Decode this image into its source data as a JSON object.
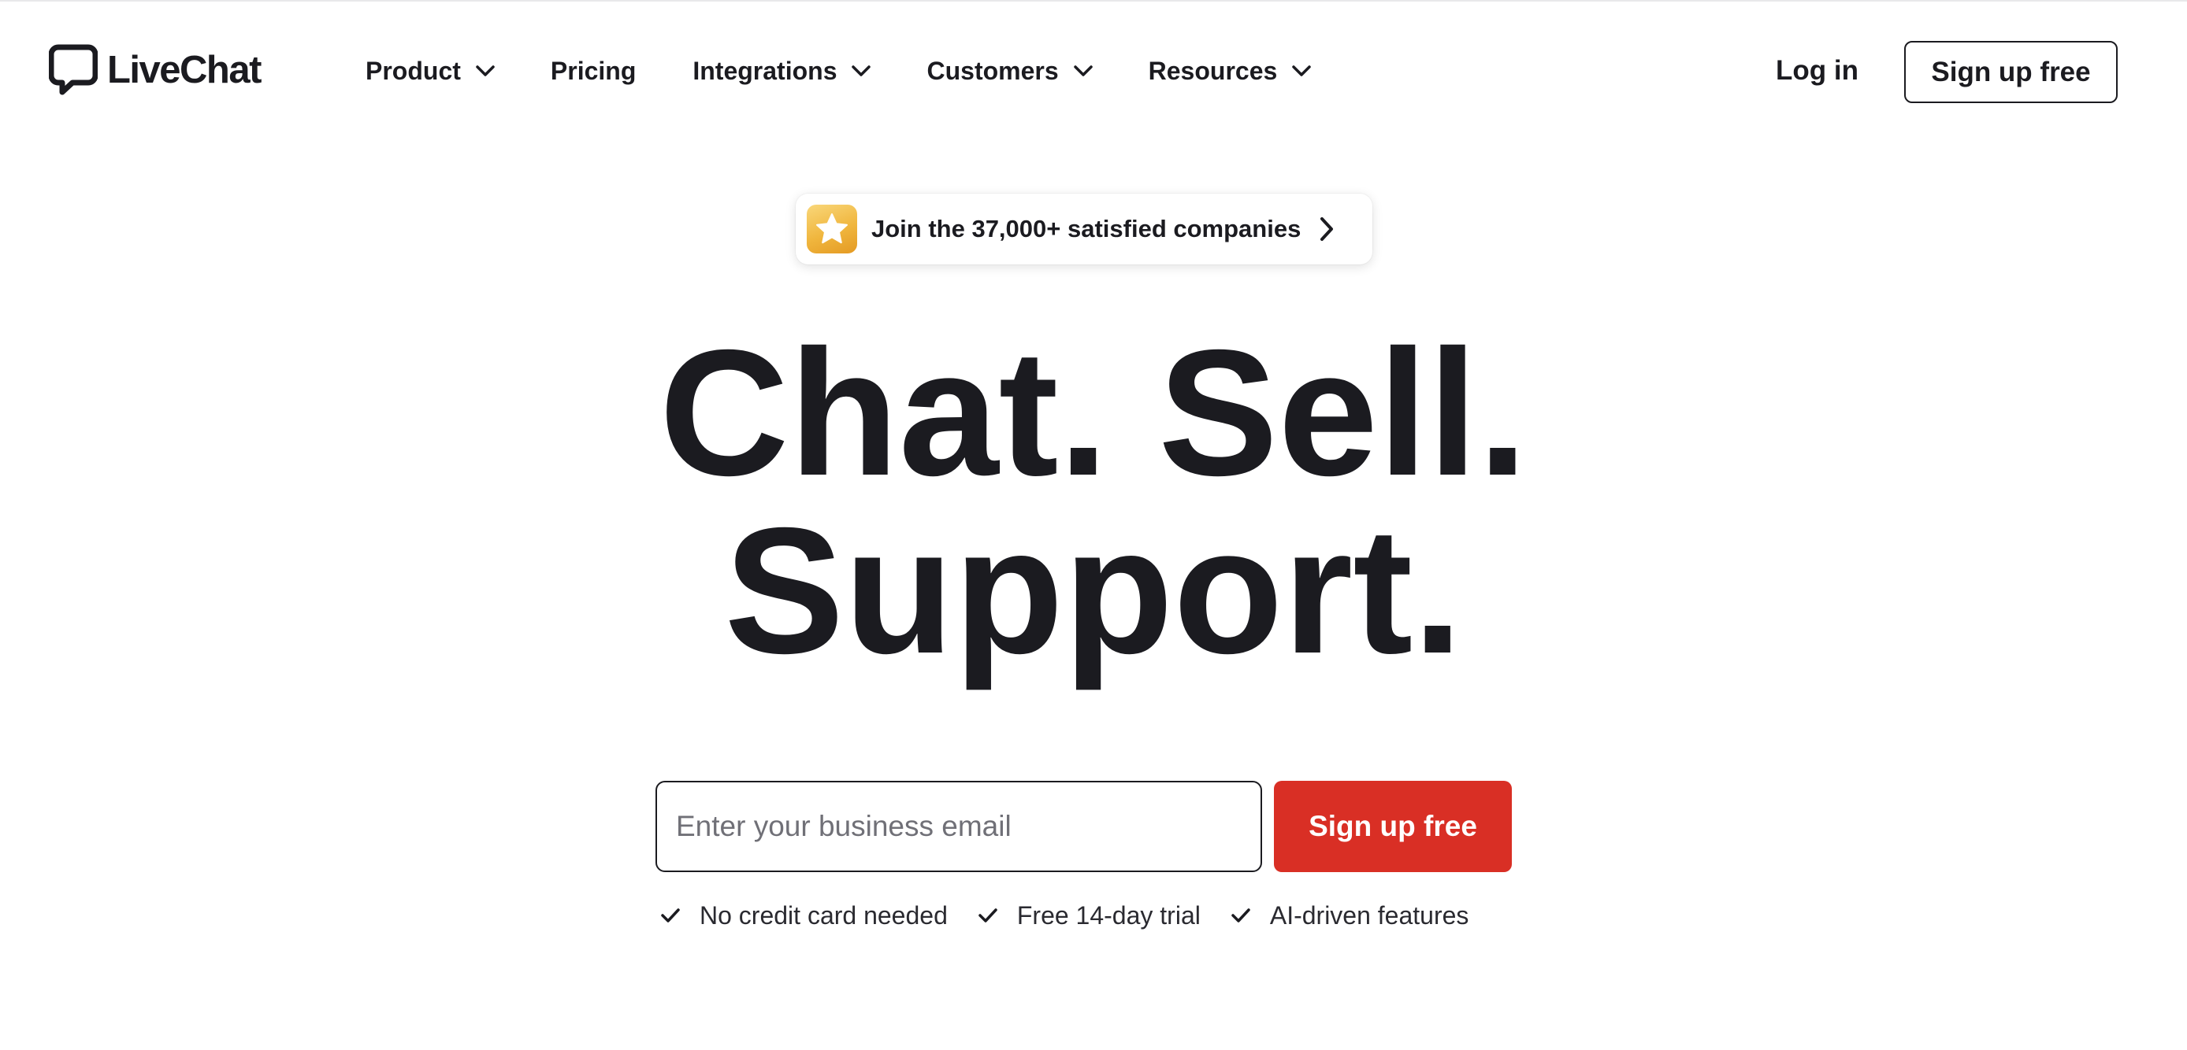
{
  "brand": {
    "name": "LiveChat",
    "logo_icon": "speech-bubble-icon"
  },
  "nav": {
    "items": [
      {
        "label": "Product",
        "has_dropdown": true
      },
      {
        "label": "Pricing",
        "has_dropdown": false
      },
      {
        "label": "Integrations",
        "has_dropdown": true
      },
      {
        "label": "Customers",
        "has_dropdown": true
      },
      {
        "label": "Resources",
        "has_dropdown": true
      }
    ],
    "login_label": "Log in",
    "signup_label": "Sign up free"
  },
  "badge": {
    "icon": "star-icon",
    "text": "Join the 37,000+ satisfied companies"
  },
  "hero": {
    "headline_line1": "Chat. Sell.",
    "headline_line2": "Support."
  },
  "signup_form": {
    "email_placeholder": "Enter your business email",
    "email_value": "",
    "submit_label": "Sign up free"
  },
  "perks": [
    "No credit card needed",
    "Free 14-day trial",
    "AI-driven features"
  ],
  "colors": {
    "text": "#1b1b20",
    "accent_red": "#d92f25",
    "badge_gold": "#f0b63e",
    "background": "#ffffff"
  }
}
